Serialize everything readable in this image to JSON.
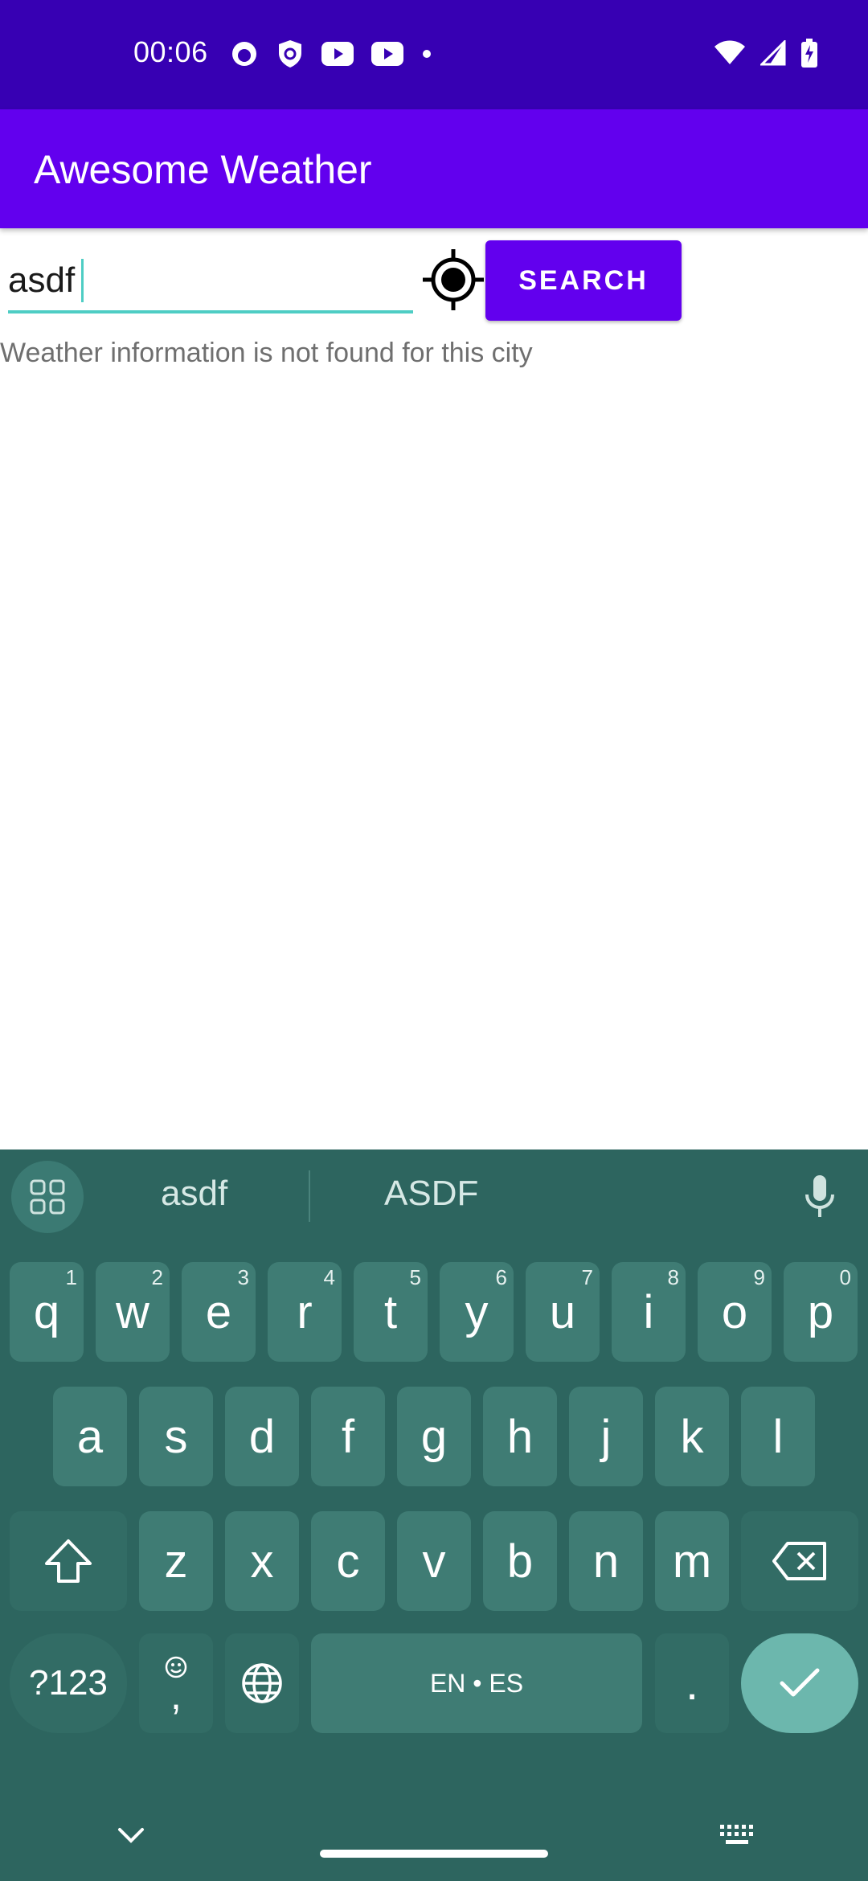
{
  "status_bar": {
    "time": "00:06"
  },
  "app_bar": {
    "title": "Awesome Weather"
  },
  "search": {
    "value": "asdf",
    "button_label": "SEARCH"
  },
  "result": {
    "message": "Weather information is not found for this city"
  },
  "keyboard": {
    "suggestions": [
      "asdf",
      "ASDF"
    ],
    "row1": [
      {
        "key": "q",
        "hint": "1"
      },
      {
        "key": "w",
        "hint": "2"
      },
      {
        "key": "e",
        "hint": "3"
      },
      {
        "key": "r",
        "hint": "4"
      },
      {
        "key": "t",
        "hint": "5"
      },
      {
        "key": "y",
        "hint": "6"
      },
      {
        "key": "u",
        "hint": "7"
      },
      {
        "key": "i",
        "hint": "8"
      },
      {
        "key": "o",
        "hint": "9"
      },
      {
        "key": "p",
        "hint": "0"
      }
    ],
    "row2": [
      "a",
      "s",
      "d",
      "f",
      "g",
      "h",
      "j",
      "k",
      "l"
    ],
    "row3": [
      "z",
      "x",
      "c",
      "v",
      "b",
      "n",
      "m"
    ],
    "symbols_label": "?123",
    "comma_label": ",",
    "space_label": "EN • ES",
    "period_label": "."
  },
  "colors": {
    "status_bar": "#3700b3",
    "app_bar": "#6200ee",
    "accent": "#4ecdc4",
    "keyboard_bg": "#2d655f",
    "key_bg": "#3f7c74",
    "enter_key": "#6cb7ad"
  }
}
